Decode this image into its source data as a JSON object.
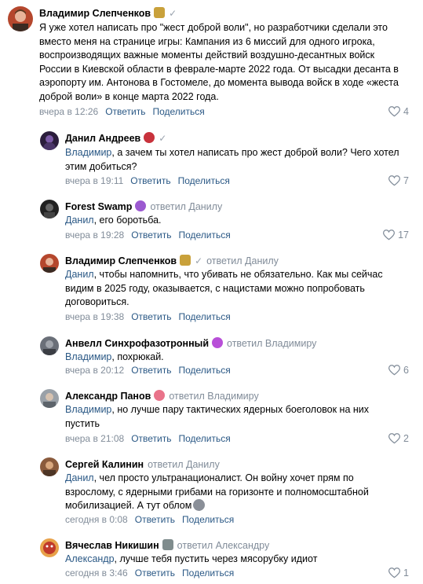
{
  "comments": [
    {
      "author": "Владимир Слепченков",
      "reply_to": "",
      "text_parts": [
        "Я уже хотел написать про \"жест доброй воли\", но разработчики сделали это вместо меня на странице игры: Кампания из 6 миссий для одного игрока, воспроизводящих важные моменты действий воздушно-десантных войск России в Киевской области в феврале-марте 2022 года. От высадки десанта в аэропорту им. Антонова в Гостомеле, до момента вывода войск в ходе «жеста доброй воли» в конце марта 2022 года."
      ],
      "time": "вчера в 12:26",
      "reply_label": "Ответить",
      "share_label": "Поделиться",
      "likes": "4"
    },
    {
      "author": "Данил Андреев",
      "reply_to": "",
      "mention": "Владимир",
      "text": ", а зачем ты хотел написать про жест доброй воли? Чего хотел этим добиться?",
      "time": "вчера в 19:11",
      "reply_label": "Ответить",
      "share_label": "Поделиться",
      "likes": "7"
    },
    {
      "author": "Forest Swamp",
      "reply_to": "ответил Данилу",
      "mention": "Данил",
      "text": ", его боротьба.",
      "time": "вчера в 19:28",
      "reply_label": "Ответить",
      "share_label": "Поделиться",
      "likes": "17"
    },
    {
      "author": "Владимир Слепченков",
      "reply_to": "ответил Данилу",
      "mention": "Данил",
      "text": ", чтобы напомнить, что убивать не обязательно. Как мы сейчас видим в 2025 году, оказывается, с нацистами можно попробовать договориться.",
      "time": "вчера в 19:38",
      "reply_label": "Ответить",
      "share_label": "Поделиться",
      "likes": ""
    },
    {
      "author": "Анвелл Синхрофазотронный",
      "reply_to": "ответил Владимиру",
      "mention": "Владимир",
      "text": ", похрюкай.",
      "time": "вчера в 20:12",
      "reply_label": "Ответить",
      "share_label": "Поделиться",
      "likes": "6"
    },
    {
      "author": "Александр Панов",
      "reply_to": "ответил Владимиру",
      "mention": "Владимир",
      "text": ", но лучше пару тактических ядерных боеголовок на них пустить",
      "time": "вчера в 21:08",
      "reply_label": "Ответить",
      "share_label": "Поделиться",
      "likes": "2"
    },
    {
      "author": "Сергей Калинин",
      "reply_to": "ответил Данилу",
      "mention": "Данил",
      "text": ", чел просто ультранационалист. Он войну хочет прям по взрослому, с ядерными грибами на горизонте и полномосштабной мобилизацией. А тут облом",
      "time": "сегодня в 0:08",
      "reply_label": "Ответить",
      "share_label": "Поделиться",
      "likes": ""
    },
    {
      "author": "Вячеслав Никишин",
      "reply_to": "ответил Александру",
      "mention": "Александр",
      "text": ", лучше тебя пустить через мясорубку идиот",
      "time": "сегодня в 3:46",
      "reply_label": "Ответить",
      "share_label": "Поделиться",
      "likes": "1"
    }
  ],
  "colors": {
    "link": "#2a5885",
    "muted": "#818c99"
  }
}
